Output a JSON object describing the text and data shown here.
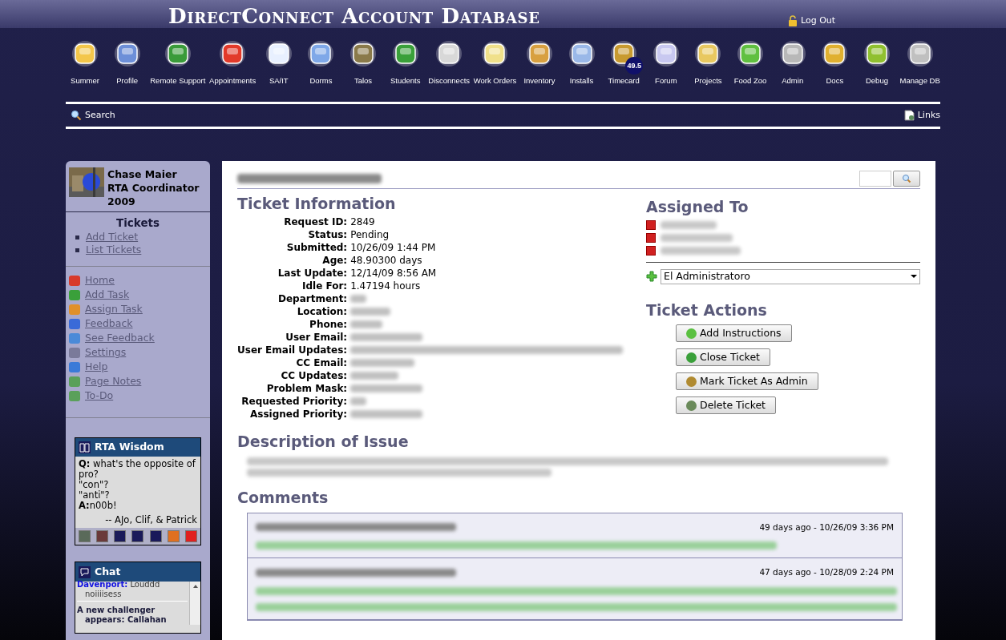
{
  "header": {
    "title": "DirectConnect Account Database",
    "logout": "Log Out"
  },
  "nav": [
    {
      "label": "Summer"
    },
    {
      "label": "Profile"
    },
    {
      "label": "Remote Support"
    },
    {
      "label": "Appointments"
    },
    {
      "label": "SA/IT"
    },
    {
      "label": "Dorms"
    },
    {
      "label": "Talos"
    },
    {
      "label": "Students"
    },
    {
      "label": "Disconnects"
    },
    {
      "label": "Work Orders"
    },
    {
      "label": "Inventory"
    },
    {
      "label": "Installs"
    },
    {
      "label": "Timecard",
      "badge": "49.5"
    },
    {
      "label": "Forum"
    },
    {
      "label": "Projects"
    },
    {
      "label": "Food Zoo"
    },
    {
      "label": "Admin"
    },
    {
      "label": "Docs"
    },
    {
      "label": "Debug"
    },
    {
      "label": "Manage DB"
    }
  ],
  "toolbar": {
    "search": "Search",
    "links": "Links"
  },
  "profile": {
    "name": "Chase Maier",
    "role": "RTA Coordinator",
    "year": "2009"
  },
  "tickets": {
    "title": "Tickets",
    "links": [
      "Add Ticket",
      "List Tickets"
    ]
  },
  "sidebar": {
    "items": [
      "Home",
      "Add Task",
      "Assign Task",
      "Feedback",
      "See Feedback",
      "Settings",
      "Help",
      "Page Notes",
      "To-Do"
    ]
  },
  "wisdom": {
    "title": "RTA Wisdom",
    "q_label": "Q:",
    "question": "what's the opposite of pro?",
    "lines": [
      "\"con\"?",
      "\"anti\"?"
    ],
    "a_label": "A:",
    "answer": "n00b!",
    "credit": "-- AJo, Clif, & Patrick"
  },
  "chat": {
    "title": "Chat",
    "messages": [
      {
        "user": "Davenport:",
        "text": "Louddd noiiiisess"
      },
      {
        "text": "A new challenger appears: Callahan",
        "kind": "system"
      }
    ]
  },
  "ticket": {
    "title": "Ticket Information",
    "fields": [
      {
        "label": "Request ID:",
        "kind": "text",
        "value": "2849"
      },
      {
        "label": "Status:",
        "kind": "text",
        "value": "Pending"
      },
      {
        "label": "Submitted:",
        "kind": "text",
        "value": "10/26/09 1:44 PM"
      },
      {
        "label": "Age:",
        "kind": "text",
        "value": "48.90300 days"
      },
      {
        "label": "Last Update:",
        "kind": "text",
        "value": "12/14/09 8:56 AM"
      },
      {
        "label": "Idle For:",
        "kind": "text",
        "value": "1.47194 hours"
      },
      {
        "label": "Department:",
        "kind": "blurred"
      },
      {
        "label": "Location:",
        "kind": "blurred"
      },
      {
        "label": "Phone:",
        "kind": "blurred"
      },
      {
        "label": "User Email:",
        "kind": "blurred"
      },
      {
        "label": "User Email Updates:",
        "kind": "blurred"
      },
      {
        "label": "CC Email:",
        "kind": "blurred"
      },
      {
        "label": "CC Updates:",
        "kind": "blurred"
      },
      {
        "label": "Problem Mask:",
        "kind": "blurred"
      },
      {
        "label": "Requested Priority:",
        "kind": "blurred"
      },
      {
        "label": "Assigned Priority:",
        "kind": "blurred"
      }
    ]
  },
  "assigned": {
    "title": "Assigned To",
    "select": "El Administratoro"
  },
  "actions": {
    "title": "Ticket Actions",
    "buttons": [
      "Add Instructions",
      "Close Ticket",
      "Mark Ticket As Admin",
      "Delete Ticket"
    ]
  },
  "description": {
    "title": "Description of Issue"
  },
  "comments": {
    "title": "Comments",
    "items": [
      {
        "time": "49 days ago - 10/26/09 3:36 PM"
      },
      {
        "time": "47 days ago - 10/28/09 2:24 PM"
      }
    ]
  }
}
